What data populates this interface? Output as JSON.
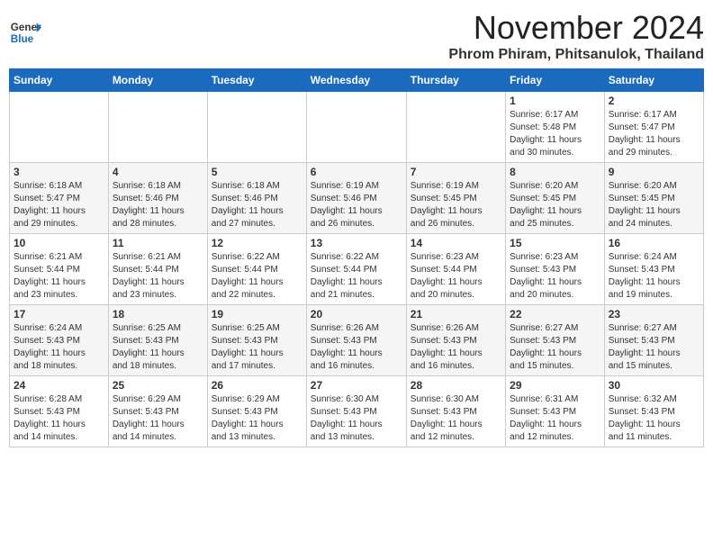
{
  "header": {
    "logo_line1": "General",
    "logo_line2": "Blue",
    "month": "November 2024",
    "location": "Phrom Phiram, Phitsanulok, Thailand"
  },
  "weekdays": [
    "Sunday",
    "Monday",
    "Tuesday",
    "Wednesday",
    "Thursday",
    "Friday",
    "Saturday"
  ],
  "weeks": [
    [
      {
        "day": "",
        "info": ""
      },
      {
        "day": "",
        "info": ""
      },
      {
        "day": "",
        "info": ""
      },
      {
        "day": "",
        "info": ""
      },
      {
        "day": "",
        "info": ""
      },
      {
        "day": "1",
        "info": "Sunrise: 6:17 AM\nSunset: 5:48 PM\nDaylight: 11 hours\nand 30 minutes."
      },
      {
        "day": "2",
        "info": "Sunrise: 6:17 AM\nSunset: 5:47 PM\nDaylight: 11 hours\nand 29 minutes."
      }
    ],
    [
      {
        "day": "3",
        "info": "Sunrise: 6:18 AM\nSunset: 5:47 PM\nDaylight: 11 hours\nand 29 minutes."
      },
      {
        "day": "4",
        "info": "Sunrise: 6:18 AM\nSunset: 5:46 PM\nDaylight: 11 hours\nand 28 minutes."
      },
      {
        "day": "5",
        "info": "Sunrise: 6:18 AM\nSunset: 5:46 PM\nDaylight: 11 hours\nand 27 minutes."
      },
      {
        "day": "6",
        "info": "Sunrise: 6:19 AM\nSunset: 5:46 PM\nDaylight: 11 hours\nand 26 minutes."
      },
      {
        "day": "7",
        "info": "Sunrise: 6:19 AM\nSunset: 5:45 PM\nDaylight: 11 hours\nand 26 minutes."
      },
      {
        "day": "8",
        "info": "Sunrise: 6:20 AM\nSunset: 5:45 PM\nDaylight: 11 hours\nand 25 minutes."
      },
      {
        "day": "9",
        "info": "Sunrise: 6:20 AM\nSunset: 5:45 PM\nDaylight: 11 hours\nand 24 minutes."
      }
    ],
    [
      {
        "day": "10",
        "info": "Sunrise: 6:21 AM\nSunset: 5:44 PM\nDaylight: 11 hours\nand 23 minutes."
      },
      {
        "day": "11",
        "info": "Sunrise: 6:21 AM\nSunset: 5:44 PM\nDaylight: 11 hours\nand 23 minutes."
      },
      {
        "day": "12",
        "info": "Sunrise: 6:22 AM\nSunset: 5:44 PM\nDaylight: 11 hours\nand 22 minutes."
      },
      {
        "day": "13",
        "info": "Sunrise: 6:22 AM\nSunset: 5:44 PM\nDaylight: 11 hours\nand 21 minutes."
      },
      {
        "day": "14",
        "info": "Sunrise: 6:23 AM\nSunset: 5:44 PM\nDaylight: 11 hours\nand 20 minutes."
      },
      {
        "day": "15",
        "info": "Sunrise: 6:23 AM\nSunset: 5:43 PM\nDaylight: 11 hours\nand 20 minutes."
      },
      {
        "day": "16",
        "info": "Sunrise: 6:24 AM\nSunset: 5:43 PM\nDaylight: 11 hours\nand 19 minutes."
      }
    ],
    [
      {
        "day": "17",
        "info": "Sunrise: 6:24 AM\nSunset: 5:43 PM\nDaylight: 11 hours\nand 18 minutes."
      },
      {
        "day": "18",
        "info": "Sunrise: 6:25 AM\nSunset: 5:43 PM\nDaylight: 11 hours\nand 18 minutes."
      },
      {
        "day": "19",
        "info": "Sunrise: 6:25 AM\nSunset: 5:43 PM\nDaylight: 11 hours\nand 17 minutes."
      },
      {
        "day": "20",
        "info": "Sunrise: 6:26 AM\nSunset: 5:43 PM\nDaylight: 11 hours\nand 16 minutes."
      },
      {
        "day": "21",
        "info": "Sunrise: 6:26 AM\nSunset: 5:43 PM\nDaylight: 11 hours\nand 16 minutes."
      },
      {
        "day": "22",
        "info": "Sunrise: 6:27 AM\nSunset: 5:43 PM\nDaylight: 11 hours\nand 15 minutes."
      },
      {
        "day": "23",
        "info": "Sunrise: 6:27 AM\nSunset: 5:43 PM\nDaylight: 11 hours\nand 15 minutes."
      }
    ],
    [
      {
        "day": "24",
        "info": "Sunrise: 6:28 AM\nSunset: 5:43 PM\nDaylight: 11 hours\nand 14 minutes."
      },
      {
        "day": "25",
        "info": "Sunrise: 6:29 AM\nSunset: 5:43 PM\nDaylight: 11 hours\nand 14 minutes."
      },
      {
        "day": "26",
        "info": "Sunrise: 6:29 AM\nSunset: 5:43 PM\nDaylight: 11 hours\nand 13 minutes."
      },
      {
        "day": "27",
        "info": "Sunrise: 6:30 AM\nSunset: 5:43 PM\nDaylight: 11 hours\nand 13 minutes."
      },
      {
        "day": "28",
        "info": "Sunrise: 6:30 AM\nSunset: 5:43 PM\nDaylight: 11 hours\nand 12 minutes."
      },
      {
        "day": "29",
        "info": "Sunrise: 6:31 AM\nSunset: 5:43 PM\nDaylight: 11 hours\nand 12 minutes."
      },
      {
        "day": "30",
        "info": "Sunrise: 6:32 AM\nSunset: 5:43 PM\nDaylight: 11 hours\nand 11 minutes."
      }
    ]
  ]
}
